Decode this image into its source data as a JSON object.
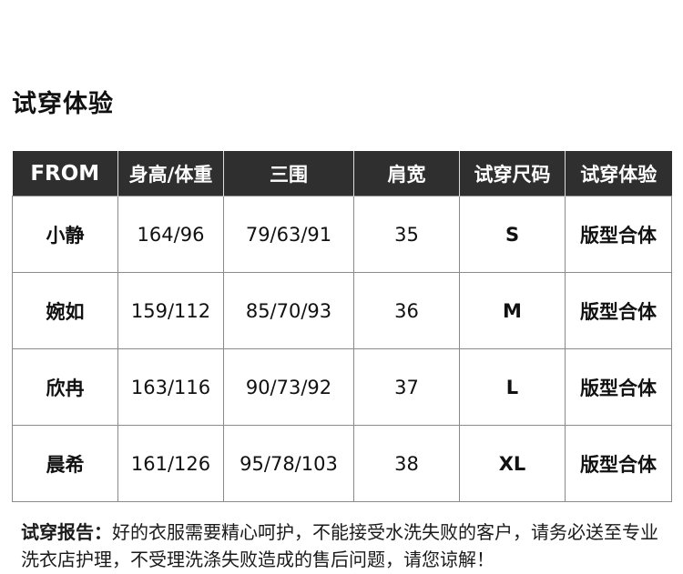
{
  "section_title": "试穿体验",
  "table": {
    "headers": [
      "FROM",
      "身高/体重",
      "三围",
      "肩宽",
      "试穿尺码",
      "试穿体验"
    ],
    "rows": [
      {
        "name": "小静",
        "height_weight": "164/96",
        "measurements": "79/63/91",
        "shoulder": "35",
        "size": "S",
        "fit": "版型合体"
      },
      {
        "name": "婉如",
        "height_weight": "159/112",
        "measurements": "85/70/93",
        "shoulder": "36",
        "size": "M",
        "fit": "版型合体"
      },
      {
        "name": "欣冉",
        "height_weight": "163/116",
        "measurements": "90/73/92",
        "shoulder": "37",
        "size": "L",
        "fit": "版型合体"
      },
      {
        "name": "晨希",
        "height_weight": "161/126",
        "measurements": "95/78/103",
        "shoulder": "38",
        "size": "XL",
        "fit": "版型合体"
      }
    ]
  },
  "note": {
    "label": "试穿报告：",
    "text": "好的衣服需要精心呵护，不能接受水洗失败的客户，请务必送至专业洗衣店护理，不受理洗涤失败造成的售后问题，请您谅解！"
  }
}
